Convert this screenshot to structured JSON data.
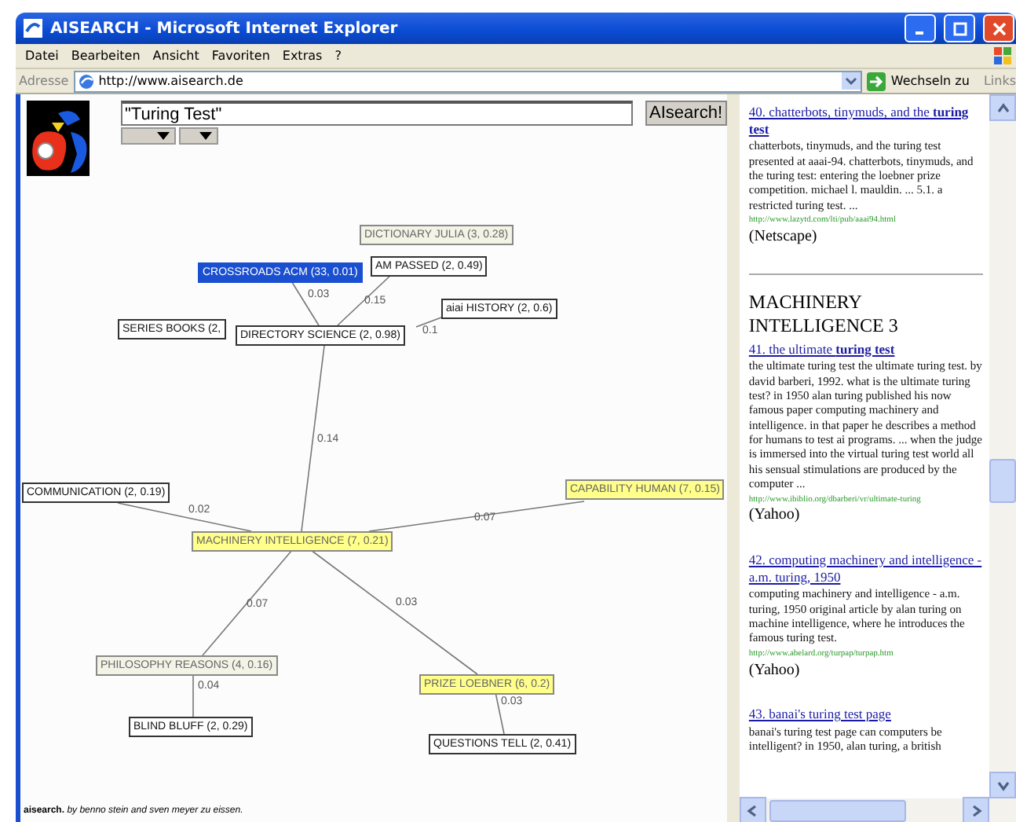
{
  "window": {
    "title": "AISEARCH - Microsoft Internet Explorer"
  },
  "menu": [
    "Datei",
    "Bearbeiten",
    "Ansicht",
    "Favoriten",
    "Extras",
    "?"
  ],
  "address": {
    "label": "Adresse",
    "url": "http://www.aisearch.de",
    "go": "Wechseln zu",
    "links": "Links"
  },
  "search": {
    "value": "\"Turing Test\"",
    "button": "AIsearch!"
  },
  "graph": {
    "nodes": [
      {
        "label": "DICTIONARY JULIA (3, 0.28)",
        "kind": "category"
      },
      {
        "label": "AM PASSED (2, 0.49)",
        "kind": "plain"
      },
      {
        "label": "CROSSROADS ACM (33, 0.01)",
        "kind": "selected"
      },
      {
        "label": "aiai HISTORY (2, 0.6)",
        "kind": "plain"
      },
      {
        "label": "SERIES BOOKS (2,",
        "kind": "plain"
      },
      {
        "label": "DIRECTORY SCIENCE (2, 0.98)",
        "kind": "plain"
      },
      {
        "label": "COMMUNICATION (2, 0.19)",
        "kind": "plain"
      },
      {
        "label": "CAPABILITY HUMAN (7, 0.15)",
        "kind": "highlight"
      },
      {
        "label": "MACHINERY INTELLIGENCE (7, 0.21)",
        "kind": "highlight"
      },
      {
        "label": "PHILOSOPHY REASONS (4, 0.16)",
        "kind": "category"
      },
      {
        "label": "BLIND BLUFF (2, 0.29)",
        "kind": "plain"
      },
      {
        "label": "PRIZE LOEBNER (6, 0.2)",
        "kind": "highlight"
      },
      {
        "label": "QUESTIONS TELL (2, 0.41)",
        "kind": "plain"
      }
    ],
    "edges": [
      "0.03",
      "0.15",
      "0.1",
      "0.14",
      "0.02",
      "0.07",
      "0.07",
      "0.03",
      "0.04",
      "0.03"
    ]
  },
  "footer": {
    "brand": "aisearch.",
    "credit": "by benno stein and sven meyer zu eissen."
  },
  "results": [
    {
      "kind": "result",
      "title": "40. chatterbots, tinymuds, and the **turing test**",
      "text": "chatterbots, tinymuds, and the turing test presented at aaai-94. chatterbots, tinymuds, and the turing test: entering the loebner prize competition. michael l. mauldin. ... 5.1. a restricted turing test. ...",
      "url": "http://www.lazytd.com/lti/pub/aaai94.html",
      "source": "(Netscape)"
    },
    {
      "kind": "heading",
      "title": "MACHINERY INTELLIGENCE 3"
    },
    {
      "kind": "result",
      "title": "41. the ultimate **turing test**",
      "text": "the ultimate turing test the ultimate turing test. by david barberi, 1992. what is the ultimate turing test? in 1950 alan turing published his now famous paper computing machinery and intelligence. in that paper he describes a method for humans to test ai programs. ... when the judge is immersed into the virtual turing test world all his sensual stimulations are produced by the computer ...",
      "url": "http://www.ibiblio.org/dbarberi/vr/ultimate-turing",
      "source": "(Yahoo)"
    },
    {
      "kind": "result",
      "title": "42. computing machinery and intelligence - a.m. turing, 1950",
      "text": "computing machinery and intelligence - a.m. turing, 1950 original article by alan turing on machine intelligence, where he introduces the famous turing test.",
      "url": "http://www.abelard.org/turpap/turpap.htm",
      "source": "(Yahoo)"
    },
    {
      "kind": "result",
      "title": "43. banai's turing test page",
      "text": "banai's turing test page can computers be intelligent? in 1950, alan turing, a british"
    }
  ]
}
